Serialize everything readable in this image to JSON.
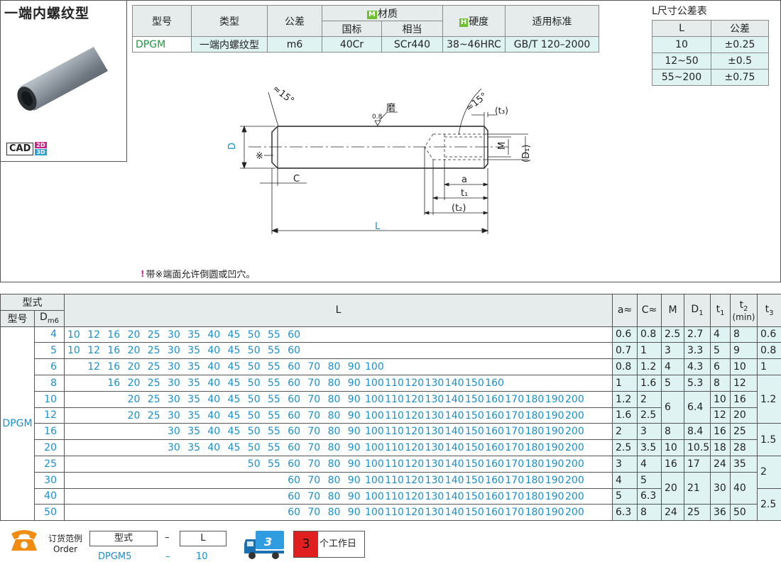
{
  "product": {
    "title": "一端内螺纹型",
    "cad": "CAD",
    "cad_2d": "2D",
    "cad_3d": "3D"
  },
  "spec": {
    "headers": {
      "code": "型号",
      "type": "类型",
      "tol": "公差",
      "material": "材质",
      "material_badge": "M",
      "gb": "国标",
      "equiv": "相当",
      "hardness": "硬度",
      "hardness_badge": "H",
      "std": "适用标准"
    },
    "row": {
      "code": "DPGM",
      "type": "一端内螺纹型",
      "tol": "m6",
      "gb": "40Cr",
      "equiv": "SCr440",
      "hardness": "38~46HRC",
      "std": "GB/T 120–2000"
    }
  },
  "tolerance": {
    "title": "L尺寸公差表",
    "headers": [
      "L",
      "公差"
    ],
    "rows": [
      [
        "10",
        "±0.25"
      ],
      [
        "12~50",
        "±0.5"
      ],
      [
        "55~200",
        "±0.75"
      ]
    ]
  },
  "drawing": {
    "angle_left": "≈15°",
    "angle_right": "≈15°",
    "grind": "磨",
    "roughness": "0.8",
    "D": "D",
    "asterisk": "※",
    "C": "C",
    "M": "M",
    "D1": "(D₁)",
    "t3": "(t₃)",
    "a": "a",
    "t1": "t₁",
    "t2": "(t₂)",
    "L": "L"
  },
  "note": {
    "icon": "!",
    "text": "带※端面允许倒圆或凹穴。"
  },
  "main": {
    "headers": {
      "form": "型式",
      "model": "型号",
      "d": "D",
      "d_sub": "m6",
      "l": "L",
      "a": "a≈",
      "c": "C≈",
      "m": "M",
      "d1": "D",
      "d1_sub": "1",
      "t1": "t",
      "t1_sub": "1",
      "t2": "t",
      "t2_sub": "2",
      "t2_min": "(min)",
      "t3": "t",
      "t3_sub": "3"
    },
    "model": "DPGM",
    "l_columns": [
      "10",
      "12",
      "16",
      "20",
      "25",
      "30",
      "35",
      "40",
      "45",
      "50",
      "55",
      "60",
      "70",
      "80",
      "90",
      "100",
      "110",
      "120",
      "130",
      "140",
      "150",
      "160",
      "170",
      "180",
      "190",
      "200"
    ],
    "rows": [
      {
        "d": "4",
        "l": [
          "10",
          "12",
          "16",
          "20",
          "25",
          "30",
          "35",
          "40",
          "45",
          "50",
          "55",
          "60"
        ],
        "a": "0.6",
        "c": "0.8",
        "m": "2.5",
        "d1": "2.7",
        "t1": "4",
        "t2": "8"
      },
      {
        "d": "5",
        "l": [
          "10",
          "12",
          "16",
          "20",
          "25",
          "30",
          "35",
          "40",
          "45",
          "50",
          "55",
          "60"
        ],
        "a": "0.7",
        "c": "1",
        "m": "3",
        "d1": "3.3",
        "t1": "5",
        "t2": "9"
      },
      {
        "d": "6",
        "l": [
          "12",
          "16",
          "20",
          "25",
          "30",
          "35",
          "40",
          "45",
          "50",
          "55",
          "60",
          "70",
          "80",
          "90",
          "100"
        ],
        "a": "0.8",
        "c": "1.2",
        "m": "4",
        "d1": "4.3",
        "t1": "6",
        "t2": "10"
      },
      {
        "d": "8",
        "l": [
          "16",
          "20",
          "25",
          "30",
          "35",
          "40",
          "45",
          "50",
          "55",
          "60",
          "70",
          "80",
          "90",
          "100",
          "110",
          "120",
          "130",
          "140",
          "150",
          "160"
        ],
        "a": "1",
        "c": "1.6",
        "m": "5",
        "d1": "5.3",
        "t1": "8",
        "t2": "12"
      },
      {
        "d": "10",
        "l": [
          "20",
          "25",
          "30",
          "35",
          "40",
          "45",
          "50",
          "55",
          "60",
          "70",
          "80",
          "90",
          "100",
          "110",
          "120",
          "130",
          "140",
          "150",
          "160",
          "170",
          "180",
          "190",
          "200"
        ],
        "a": "1.2",
        "c": "2",
        "m": "6",
        "d1": "6.4",
        "t1": "10",
        "t2": "16"
      },
      {
        "d": "12",
        "l": [
          "20",
          "25",
          "30",
          "35",
          "40",
          "45",
          "50",
          "55",
          "60",
          "70",
          "80",
          "90",
          "100",
          "110",
          "120",
          "130",
          "140",
          "150",
          "160",
          "170",
          "180",
          "190",
          "200"
        ],
        "a": "1.6",
        "c": "2.5",
        "m": "",
        "d1": "",
        "t1": "12",
        "t2": "20"
      },
      {
        "d": "16",
        "l": [
          "30",
          "35",
          "40",
          "45",
          "50",
          "55",
          "60",
          "70",
          "80",
          "90",
          "100",
          "110",
          "120",
          "130",
          "140",
          "150",
          "160",
          "170",
          "180",
          "190",
          "200"
        ],
        "a": "2",
        "c": "3",
        "m": "8",
        "d1": "8.4",
        "t1": "16",
        "t2": "25"
      },
      {
        "d": "20",
        "l": [
          "30",
          "35",
          "40",
          "45",
          "50",
          "55",
          "60",
          "70",
          "80",
          "90",
          "100",
          "110",
          "120",
          "130",
          "140",
          "150",
          "160",
          "170",
          "180",
          "190",
          "200"
        ],
        "a": "2.5",
        "c": "3.5",
        "m": "10",
        "d1": "10.5",
        "t1": "18",
        "t2": "28"
      },
      {
        "d": "25",
        "l": [
          "50",
          "55",
          "60",
          "70",
          "80",
          "90",
          "100",
          "110",
          "120",
          "130",
          "140",
          "150",
          "160",
          "170",
          "180",
          "190",
          "200"
        ],
        "a": "3",
        "c": "4",
        "m": "16",
        "d1": "17",
        "t1": "24",
        "t2": "35"
      },
      {
        "d": "30",
        "l": [
          "60",
          "70",
          "80",
          "90",
          "100",
          "110",
          "120",
          "130",
          "140",
          "150",
          "160",
          "170",
          "180",
          "190",
          "200"
        ],
        "a": "4",
        "c": "5",
        "m": "20",
        "d1": "21",
        "t1": "30",
        "t2": "40"
      },
      {
        "d": "40",
        "l": [
          "60",
          "70",
          "80",
          "90",
          "100",
          "110",
          "120",
          "130",
          "140",
          "150",
          "160",
          "170",
          "180",
          "190",
          "200"
        ],
        "a": "5",
        "c": "6.3",
        "m": "",
        "d1": "",
        "t1": "",
        "t2": ""
      },
      {
        "d": "50",
        "l": [
          "60",
          "70",
          "80",
          "90",
          "100",
          "110",
          "120",
          "130",
          "140",
          "150",
          "160",
          "170",
          "180",
          "190",
          "200"
        ],
        "a": "6.3",
        "c": "8",
        "m": "24",
        "d1": "25",
        "t1": "36",
        "t2": "50"
      }
    ],
    "t3": [
      "0.6",
      "0.8",
      "1",
      "1.2",
      "1.5",
      "2",
      "2.5"
    ]
  },
  "order": {
    "label_cn": "订货范例",
    "label_en": "Order",
    "box_type": "型式",
    "dash": "–",
    "box_l": "L",
    "example_code": "DPGM5",
    "example_dash": "–",
    "example_l": "10",
    "lead_num": "3",
    "lead_text": "个工作日",
    "truck_badge": "3"
  },
  "colors": {
    "accent_blue": "#1a8fd0",
    "code_green": "#1a9a3a",
    "cell_bg": "#e0f3f3",
    "head_bg": "#e6ecec",
    "lead_red": "#e02020"
  }
}
